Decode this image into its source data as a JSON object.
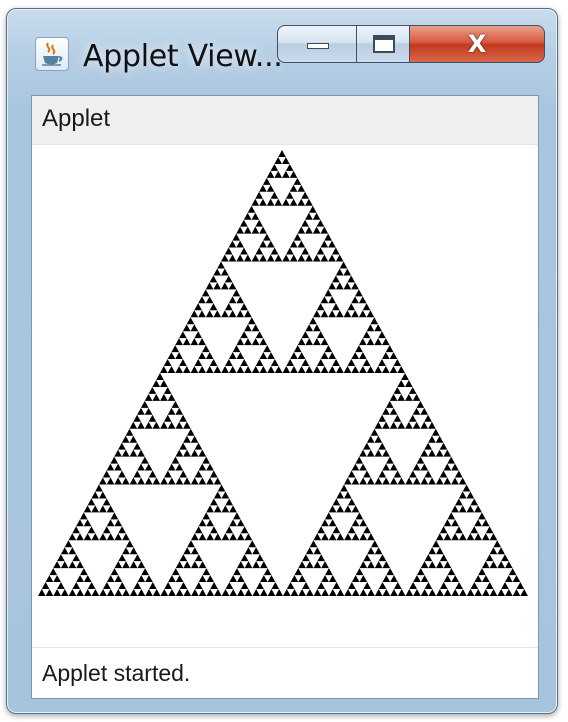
{
  "window": {
    "title": "Applet View...",
    "icon": "java-coffee-cup-icon"
  },
  "titlebar_buttons": {
    "minimize_icon": "minimize-icon",
    "maximize_icon": "maximize-icon",
    "close_glyph": "X"
  },
  "menu": {
    "items": [
      {
        "label": "Applet"
      }
    ]
  },
  "canvas": {
    "content": "sierpinski-triangle",
    "fill_color": "#000000",
    "background_color": "#ffffff",
    "recursion_depth": 6
  },
  "status": {
    "text": "Applet started."
  }
}
